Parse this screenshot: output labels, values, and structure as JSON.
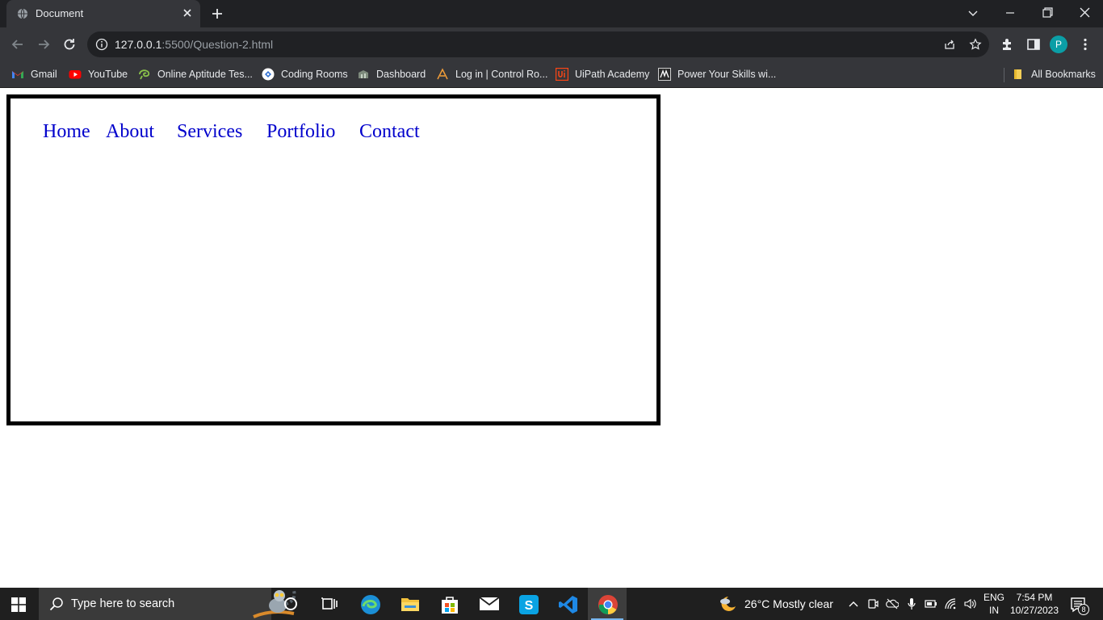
{
  "browser": {
    "tab_title": "Document",
    "url_host": "127.0.0.1",
    "url_rest": ":5500/Question-2.html",
    "profile_initial": "P",
    "bookmarks": [
      {
        "label": "Gmail",
        "icon": "gmail-icon"
      },
      {
        "label": "YouTube",
        "icon": "youtube-icon"
      },
      {
        "label": "Online Aptitude Tes...",
        "icon": "aptitude-icon"
      },
      {
        "label": "Coding Rooms",
        "icon": "coding-rooms-icon"
      },
      {
        "label": "Dashboard",
        "icon": "dashboard-icon"
      },
      {
        "label": "Log in | Control Ro...",
        "icon": "control-room-icon"
      },
      {
        "label": "UiPath Academy",
        "icon": "uipath-icon"
      },
      {
        "label": "Power Your Skills wi...",
        "icon": "skills-icon"
      }
    ],
    "all_bookmarks": "All Bookmarks"
  },
  "page": {
    "nav_links": [
      "Home",
      "About",
      "Services",
      "Portfolio",
      "Contact"
    ],
    "link_color": "#0000cc",
    "border_color": "#000000"
  },
  "taskbar": {
    "search_placeholder": "Type here to search",
    "weather": "26°C  Mostly clear",
    "lang_line1": "ENG",
    "lang_line2": "IN",
    "time": "7:54 PM",
    "date": "10/27/2023",
    "notification_count": "8",
    "apps": [
      "cortana-icon",
      "task-view-icon",
      "edge-icon",
      "file-explorer-icon",
      "store-icon",
      "mail-icon",
      "skype-icon",
      "vscode-icon",
      "chrome-icon"
    ]
  }
}
